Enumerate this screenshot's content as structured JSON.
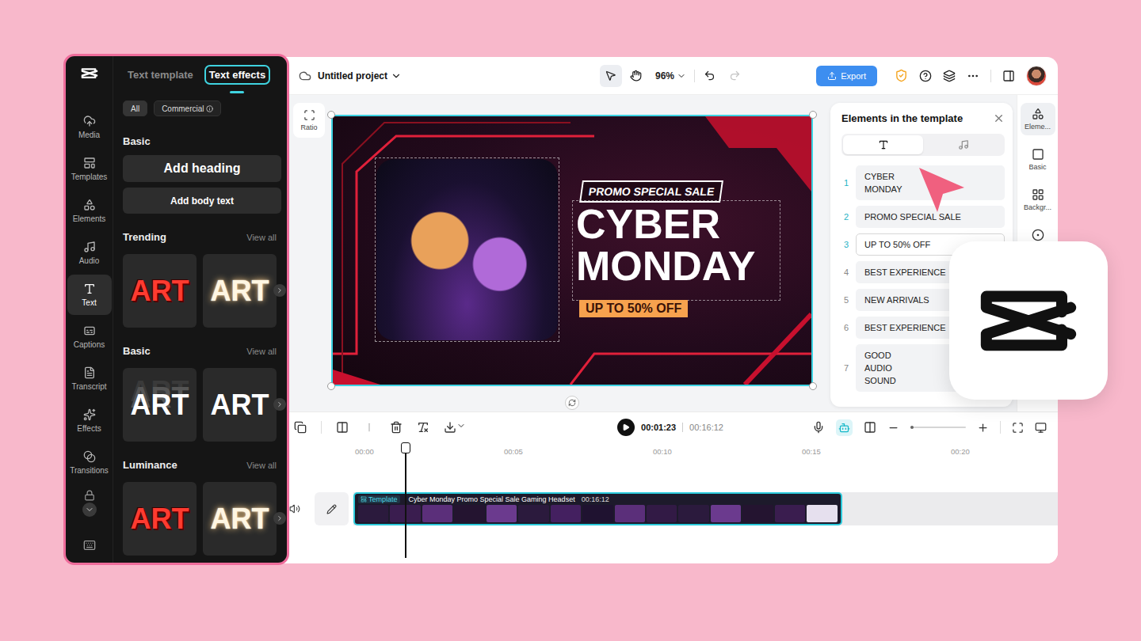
{
  "sidebar": {
    "items": [
      {
        "kind": "media",
        "label": "Media",
        "selected": false
      },
      {
        "kind": "templates",
        "label": "Templates",
        "selected": false
      },
      {
        "kind": "elements",
        "label": "Elements",
        "selected": false
      },
      {
        "kind": "audio",
        "label": "Audio",
        "selected": false
      },
      {
        "kind": "text",
        "label": "Text",
        "selected": true
      },
      {
        "kind": "captions",
        "label": "Captions",
        "selected": false
      },
      {
        "kind": "transcript",
        "label": "Transcript",
        "selected": false
      },
      {
        "kind": "effects",
        "label": "Effects",
        "selected": false
      },
      {
        "kind": "transitions",
        "label": "Transitions",
        "selected": false
      }
    ]
  },
  "text_panel": {
    "tabs": [
      {
        "label": "Text template",
        "selected": false
      },
      {
        "label": "Text effects",
        "selected": true
      }
    ],
    "filters": [
      {
        "label": "All",
        "selected": true,
        "info": false
      },
      {
        "label": "Commercial",
        "selected": false,
        "info": true
      }
    ],
    "basic": {
      "title": "Basic",
      "heading_button": "Add heading",
      "body_button": "Add body text"
    },
    "sections": [
      {
        "title": "Trending",
        "view_all": "View all",
        "cards": [
          {
            "text": "ART",
            "kind": "red"
          },
          {
            "text": "ART",
            "kind": "glow"
          }
        ]
      },
      {
        "title": "Basic",
        "view_all": "View all",
        "cards": [
          {
            "text": "ART",
            "kind": "outline"
          },
          {
            "text": "ART",
            "kind": "plain"
          }
        ]
      },
      {
        "title": "Luminance",
        "view_all": "View all",
        "cards": [
          {
            "text": "ART",
            "kind": "red"
          },
          {
            "text": "ART",
            "kind": "glow"
          }
        ]
      }
    ]
  },
  "topbar": {
    "project": "Untitled project",
    "zoom": "96%",
    "export": "Export",
    "redo_disabled": true,
    "tools": [
      {
        "kind": "select",
        "selected": true
      },
      {
        "kind": "hand",
        "selected": false
      }
    ]
  },
  "canvas": {
    "ratio": "Ratio",
    "badge": "PROMO SPECIAL SALE",
    "headline": [
      "CYBER",
      "MONDAY"
    ],
    "offer": "UP TO 50% OFF",
    "selected": true
  },
  "elements_panel": {
    "title": "Elements in the template",
    "tabs": [
      {
        "kind": "text",
        "selected": true
      },
      {
        "kind": "audio",
        "selected": false
      }
    ],
    "items": [
      {
        "index": "1",
        "text": "CYBER\nMONDAY",
        "active": true,
        "selected": false
      },
      {
        "index": "2",
        "text": "PROMO SPECIAL SALE",
        "active": true,
        "selected": false
      },
      {
        "index": "3",
        "text": "UP TO 50% OFF",
        "active": true,
        "selected": true
      },
      {
        "index": "4",
        "text": "BEST EXPERIENCE",
        "active": false,
        "selected": false
      },
      {
        "index": "5",
        "text": "NEW ARRIVALS",
        "active": false,
        "selected": false
      },
      {
        "index": "6",
        "text": "BEST EXPERIENCE",
        "active": false,
        "selected": false
      },
      {
        "index": "7",
        "text": "GOOD\nAUDIO\nSOUND",
        "active": false,
        "selected": false
      }
    ]
  },
  "right_rail": {
    "items": [
      {
        "kind": "elements",
        "label": "Eleme...",
        "selected": true
      },
      {
        "kind": "basic",
        "label": "Basic",
        "selected": false
      },
      {
        "kind": "background",
        "label": "Backgr...",
        "selected": false
      },
      {
        "kind": "more",
        "selected": false
      }
    ]
  },
  "timeline": {
    "time_current": "00:01:23",
    "time_total": "00:16:12",
    "ruler": [
      "00:00",
      "00:05",
      "00:10",
      "00:15",
      "00:20"
    ],
    "zoom_level": 0.05,
    "split_disabled": true,
    "ai_on": true,
    "clip": {
      "badge": "Template",
      "title": "Cyber Monday Promo Special Sale Gaming Headset",
      "duration": "00:16:12",
      "selected": true
    }
  }
}
